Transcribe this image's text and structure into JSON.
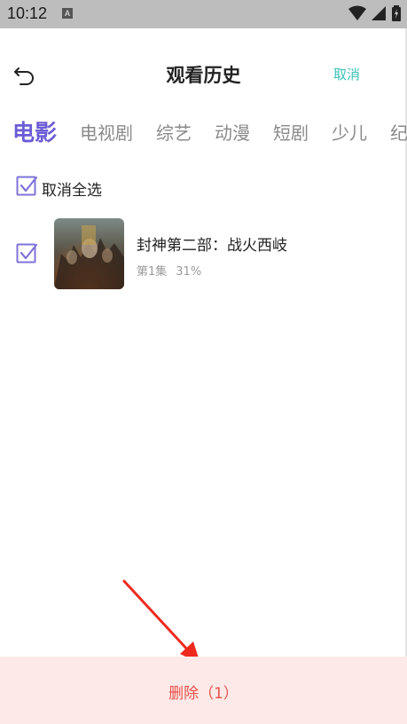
{
  "status_bar": {
    "time": "10:12",
    "notification_badge": "A"
  },
  "header": {
    "title": "观看历史",
    "cancel_label": "取消",
    "back_icon": "back-arrow-icon"
  },
  "tabs": [
    {
      "label": "电影",
      "active": true
    },
    {
      "label": "电视剧",
      "active": false
    },
    {
      "label": "综艺",
      "active": false
    },
    {
      "label": "动漫",
      "active": false
    },
    {
      "label": "短剧",
      "active": false
    },
    {
      "label": "少儿",
      "active": false
    },
    {
      "label": "纪",
      "active": false
    }
  ],
  "select_all": {
    "label": "取消全选",
    "checked": true
  },
  "items": [
    {
      "title": "封神第二部：战火西岐",
      "episode": "第1集",
      "progress": "31%",
      "checked": true
    }
  ],
  "bottom": {
    "delete_label": "删除（1）"
  },
  "colors": {
    "accent_purple": "#6b5cd6",
    "cancel_teal": "#3cc1b8",
    "delete_red": "#e8504a",
    "bottom_bg": "#fde9e7",
    "checkbox": "#7f73d9",
    "annotation_arrow": "#ee2a1f"
  }
}
